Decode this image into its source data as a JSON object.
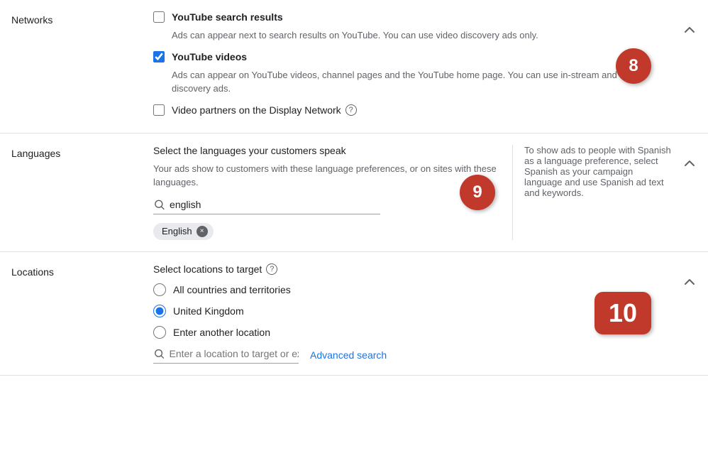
{
  "networks": {
    "label": "Networks",
    "collapse_label": "collapse",
    "items": [
      {
        "id": "youtube-search",
        "label": "YouTube search results",
        "checked": false,
        "description": "Ads can appear next to search results on YouTube. You can use video discovery ads only."
      },
      {
        "id": "youtube-videos",
        "label": "YouTube videos",
        "checked": true,
        "description": "Ads can appear on YouTube videos, channel pages and the YouTube home page. You can use in-stream and video discovery ads."
      },
      {
        "id": "display-network",
        "label": "Video partners on the Display Network",
        "checked": false,
        "description": null
      }
    ],
    "step_badge": "8"
  },
  "languages": {
    "label": "Languages",
    "instruction": "Select the languages your customers speak",
    "sub_text": "Your ads show to customers with these language preferences, or on sites with these languages.",
    "search_placeholder": "english",
    "selected_language": "English",
    "aside_text": "To show ads to people with Spanish as a language preference, select Spanish as your campaign language and use Spanish ad text and keywords.",
    "step_badge": "9",
    "collapse_label": "collapse"
  },
  "locations": {
    "label": "Locations",
    "instruction": "Select locations to target",
    "options": [
      {
        "id": "all",
        "label": "All countries and territories",
        "selected": false
      },
      {
        "id": "uk",
        "label": "United Kingdom",
        "selected": true
      },
      {
        "id": "other",
        "label": "Enter another location",
        "selected": false
      }
    ],
    "search_placeholder": "Enter a location to target or exclude",
    "advanced_search_label": "Advanced search",
    "step_badge": "10",
    "collapse_label": "collapse"
  },
  "icons": {
    "search": "🔍",
    "help": "?",
    "close": "×",
    "chevron_up": "^"
  }
}
